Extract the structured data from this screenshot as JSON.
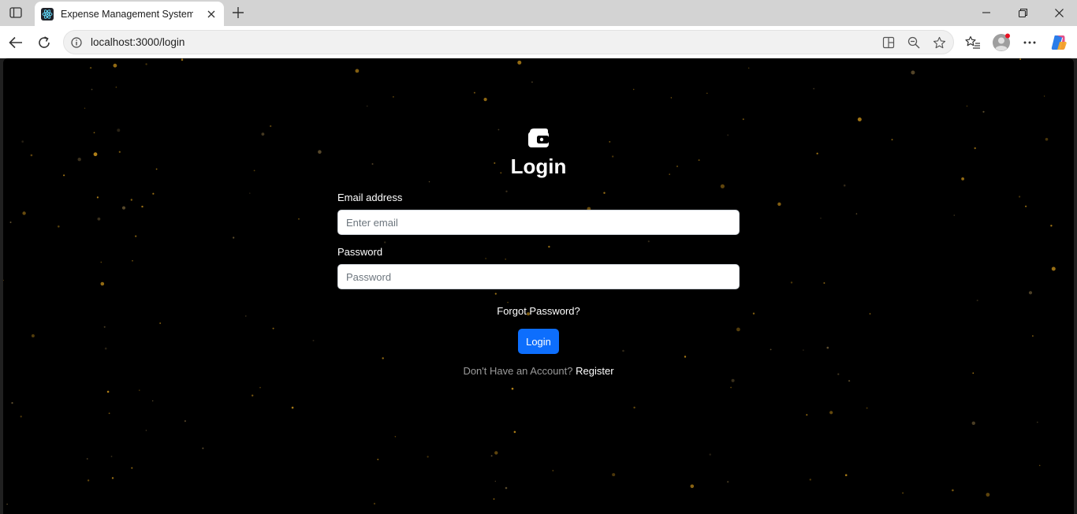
{
  "browser": {
    "tab_title": "Expense Management System.",
    "url": "localhost:3000/login"
  },
  "icons": {
    "sidebar_toggle": "tab-actions-icon",
    "favicon": "react-icon",
    "tab_close": "close-icon",
    "new_tab": "plus-icon",
    "back": "back-arrow-icon",
    "refresh": "refresh-icon",
    "site_info": "info-icon",
    "split_screen": "split-screen-icon",
    "zoom": "zoom-out-icon",
    "favorite": "star-icon",
    "favorites": "favorites-icon",
    "profile": "profile-icon",
    "more": "more-icon",
    "copilot": "copilot-icon",
    "logo": "wallet-icon"
  },
  "login": {
    "heading": "Login",
    "email_label": "Email address",
    "email_placeholder": "Enter email",
    "email_value": "",
    "password_label": "Password",
    "password_placeholder": "Password",
    "password_value": "",
    "forgot_link": "Forgot Password?",
    "submit_label": "Login",
    "register_prompt": "Don't Have an Account?",
    "register_link": "Register"
  },
  "colors": {
    "page_bg": "#000000",
    "button_primary": "#0d6efd",
    "star_gold": "#c8911a"
  }
}
